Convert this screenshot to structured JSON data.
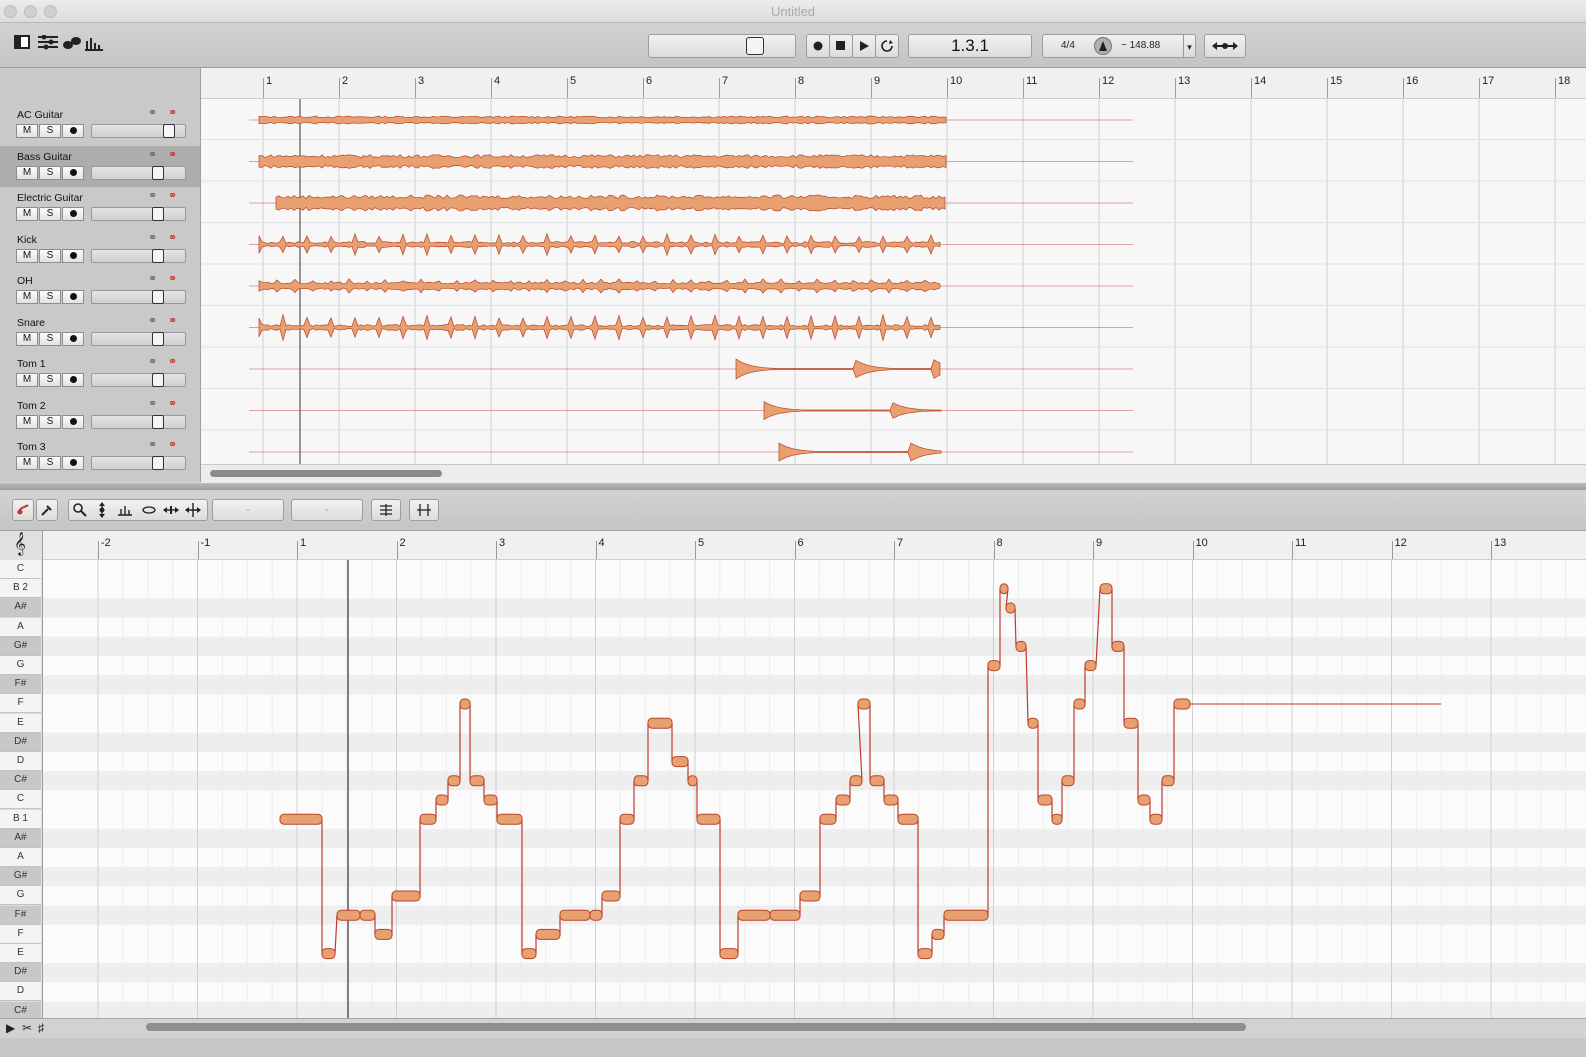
{
  "window": {
    "title": "Untitled"
  },
  "transport": {
    "position": "1.3.1",
    "time_signature": "4/4",
    "tempo": "~ 148.88",
    "buttons": [
      "record",
      "stop",
      "play",
      "loop"
    ]
  },
  "tracks": [
    {
      "name": "AC Guitar",
      "selected": false,
      "level": 0.85
    },
    {
      "name": "Bass Guitar",
      "selected": true,
      "level": 0.73
    },
    {
      "name": "Electric Guitar",
      "selected": false,
      "level": 0.73
    },
    {
      "name": "Kick",
      "selected": false,
      "level": 0.73
    },
    {
      "name": "OH",
      "selected": false,
      "level": 0.73
    },
    {
      "name": "Snare",
      "selected": false,
      "level": 0.73
    },
    {
      "name": "Tom 1",
      "selected": false,
      "level": 0.73
    },
    {
      "name": "Tom 2",
      "selected": false,
      "level": 0.73
    },
    {
      "name": "Tom 3",
      "selected": false,
      "level": 0.73
    }
  ],
  "mute_label": "M",
  "solo_label": "S",
  "arrange_ruler": [
    "1",
    "2",
    "3",
    "4",
    "5",
    "6",
    "7",
    "8",
    "9",
    "10",
    "11",
    "12",
    "13",
    "14",
    "15",
    "16",
    "17",
    "18"
  ],
  "editor_ruler": [
    "-2",
    "-1",
    "1",
    "2",
    "3",
    "4",
    "5",
    "6",
    "7",
    "8",
    "9",
    "10",
    "11",
    "12",
    "13"
  ],
  "pitch_keys": [
    "C",
    "B 2",
    "A#",
    "A",
    "G#",
    "G",
    "F#",
    "F",
    "E",
    "D#",
    "D",
    "C#",
    "C",
    "B 1",
    "A#",
    "A",
    "G#",
    "G",
    "F#",
    "F",
    "E",
    "D#",
    "D",
    "C#"
  ],
  "editor_fields": [
    "-",
    "-"
  ],
  "colors": {
    "accent": "#c0392b",
    "blob": "#e8a070",
    "blob_edge": "#b8452a"
  }
}
